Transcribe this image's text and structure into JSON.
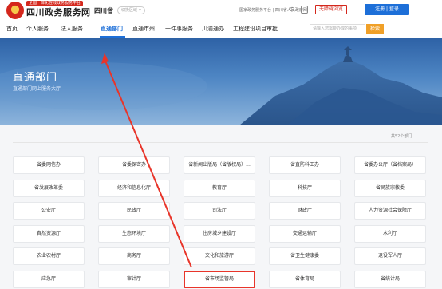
{
  "header": {
    "slogan": "全国一体化在线政务服务平台",
    "site_name": "四川政务服务网",
    "region": "四川省",
    "switch_label": "切换区域 ∨",
    "gov_links": "国家政务服务平台 | 四川省人民政府网",
    "care_label": "无障碍浏览",
    "login_label": "注册 | 登录"
  },
  "nav": {
    "items": [
      "首页",
      "个人服务",
      "法人服务",
      "直通部门",
      "直通市州",
      "一件事服务",
      "川渝通办",
      "工程建设项目审批"
    ],
    "active_index": 3,
    "search_placeholder": "请输入您需要办理的事项",
    "search_label": "检索"
  },
  "banner": {
    "title": "直通部门",
    "subtitle": "直通部门网上服务大厅"
  },
  "content": {
    "count_label": "共52个部门",
    "departments": [
      "省委网信办",
      "省委保密办",
      "省新闻出版局（省版权局）...",
      "省直防科工办",
      "省委办公厅（省档案局）",
      "省发展改革委",
      "经济和信息化厅",
      "教育厅",
      "科技厅",
      "省民族宗教委",
      "公安厅",
      "民政厅",
      "司法厅",
      "财政厅",
      "人力资源社会保障厅",
      "自然资源厅",
      "生态环境厅",
      "住房城乡建设厅",
      "交通运输厅",
      "水利厅",
      "农业农村厅",
      "商务厅",
      "文化和旅游厅",
      "省卫生健康委",
      "退役军人厅",
      "应急厅",
      "审计厅",
      "省市场监管局",
      "省体育局",
      "省统计局"
    ],
    "highlighted_index": 27
  },
  "colors": {
    "brand_blue": "#1d6fd8",
    "annotation_red": "#e8352a",
    "search_orange": "#f0a028"
  }
}
